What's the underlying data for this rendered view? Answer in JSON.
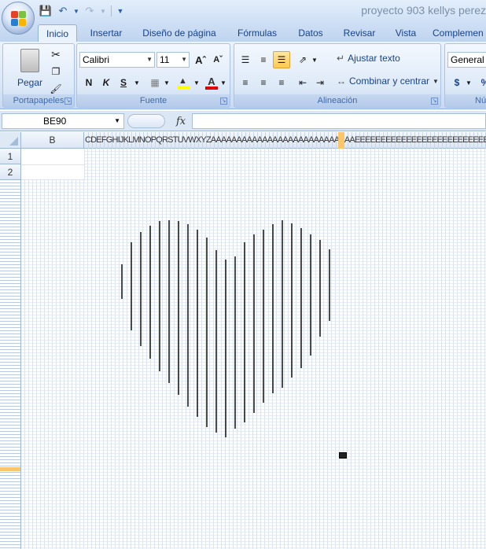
{
  "window": {
    "title": "proyecto 903 kellys perez"
  },
  "tabs": [
    "Inicio",
    "Insertar",
    "Diseño de página",
    "Fórmulas",
    "Datos",
    "Revisar",
    "Vista",
    "Complemen"
  ],
  "ribbon": {
    "clipboard": {
      "label": "Portapapeles",
      "paste": "Pegar"
    },
    "font": {
      "label": "Fuente",
      "name": "Calibri",
      "size": "11",
      "bold": "N",
      "italic": "K",
      "underline": "S"
    },
    "alignment": {
      "label": "Alineación",
      "wrap_text": "Ajustar texto",
      "merge_center": "Combinar y centrar"
    },
    "number": {
      "label": "Nú",
      "format": "General",
      "currency": "$",
      "percent": "%"
    }
  },
  "formula_bar": {
    "name_box": "BE90",
    "fx": "fx",
    "value": ""
  },
  "sheet": {
    "col_b": "B",
    "narrow_header_text": "CDEFGHIJKLMNOPQRSTUVWXYZAAAAAAAAAAAAAAAAAAAAAAAAAAAAEEEEEEEEEEEEEEEEEEEEEEEEEEECCCCC",
    "row_1": "1",
    "row_2": "2"
  },
  "colors": {
    "highlight": "#f9c769",
    "ribbon": "#dbe8f8",
    "accent": "#15428b"
  }
}
